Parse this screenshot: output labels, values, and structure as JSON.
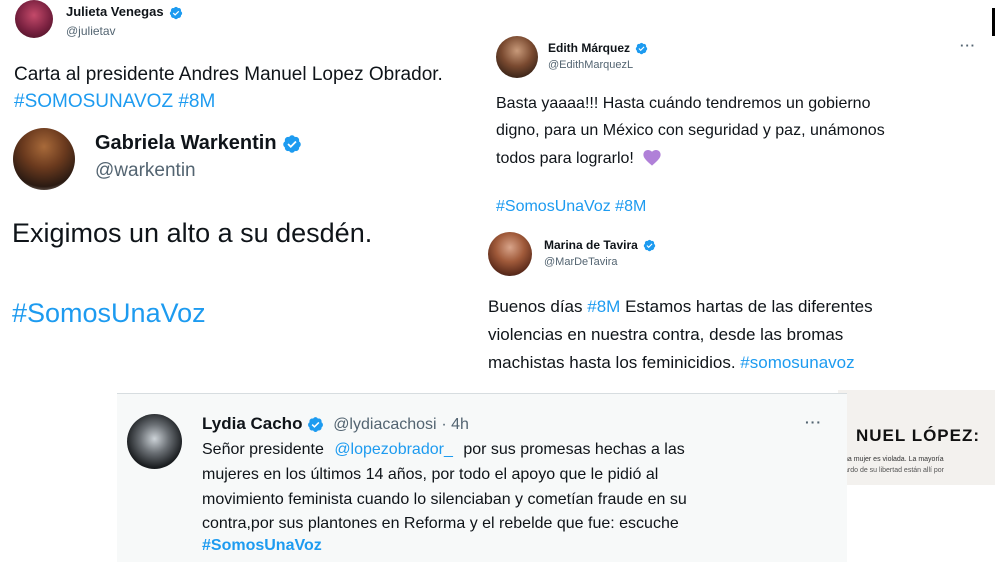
{
  "colors": {
    "link": "#1d9bf0",
    "verified": "#1d9bf0",
    "muted": "#536471",
    "heart": "#b080d8"
  },
  "tweets": [
    {
      "id": "julieta",
      "name": "Julieta Venegas",
      "handle": "@julietav",
      "text": "Carta al presidente Andres Manuel Lopez Obrador.",
      "hashtags": "#SOMOSUNAVOZ #8M",
      "quoted": {
        "name": "Gabriela Warkentin",
        "handle": "@warkentin",
        "text": "Exigimos un alto a su desdén.",
        "hashtag": "#SomosUnaVoz"
      }
    },
    {
      "id": "edith",
      "name": "Edith Márquez",
      "handle": "@EdithMarquezL",
      "lines": [
        "Basta yaaaa!!! Hasta cuándo tendremos un gobierno",
        "digno, para un México con seguridad y paz, unámonos",
        "todos para lograrlo!"
      ],
      "emoji": "💜",
      "hashtags": "#SomosUnaVoz #8M",
      "more": "···"
    },
    {
      "id": "marina",
      "name": "Marina de Tavira",
      "handle": "@MarDeTavira",
      "line1_pre": "Buenos días",
      "line1_tag": "#8M",
      "line1_post": "Estamos hartas de las diferentes",
      "line2": "violencias en nuestra contra, desde las bromas",
      "line3_pre": "machistas hasta los feminicidios.",
      "line3_tag": "#somosunavoz"
    },
    {
      "id": "lydia",
      "name": "Lydia Cacho",
      "handle": "@lydiacachosi",
      "time": "· 4h",
      "line1_pre": "Señor presidente",
      "line1_mention": "@lopezobrador_",
      "line1_post": "por sus promesas hechas a las",
      "line2": "mujeres en los últimos 14 años, por todo el apoyo que le pidió al",
      "line3": "movimiento feminista cuando lo silenciaban y cometían fraude en su",
      "line4": "contra,por sus plantones en Reforma y el rebelde que fue: escuche",
      "hashtag": "#SomosUnaVoz",
      "more": "···"
    }
  ],
  "article": {
    "headline": "NUEL LÓPEZ:",
    "snippet1": "na mujer es violada. La mayoría",
    "snippet2": "ardo de su libertad están allí por"
  }
}
